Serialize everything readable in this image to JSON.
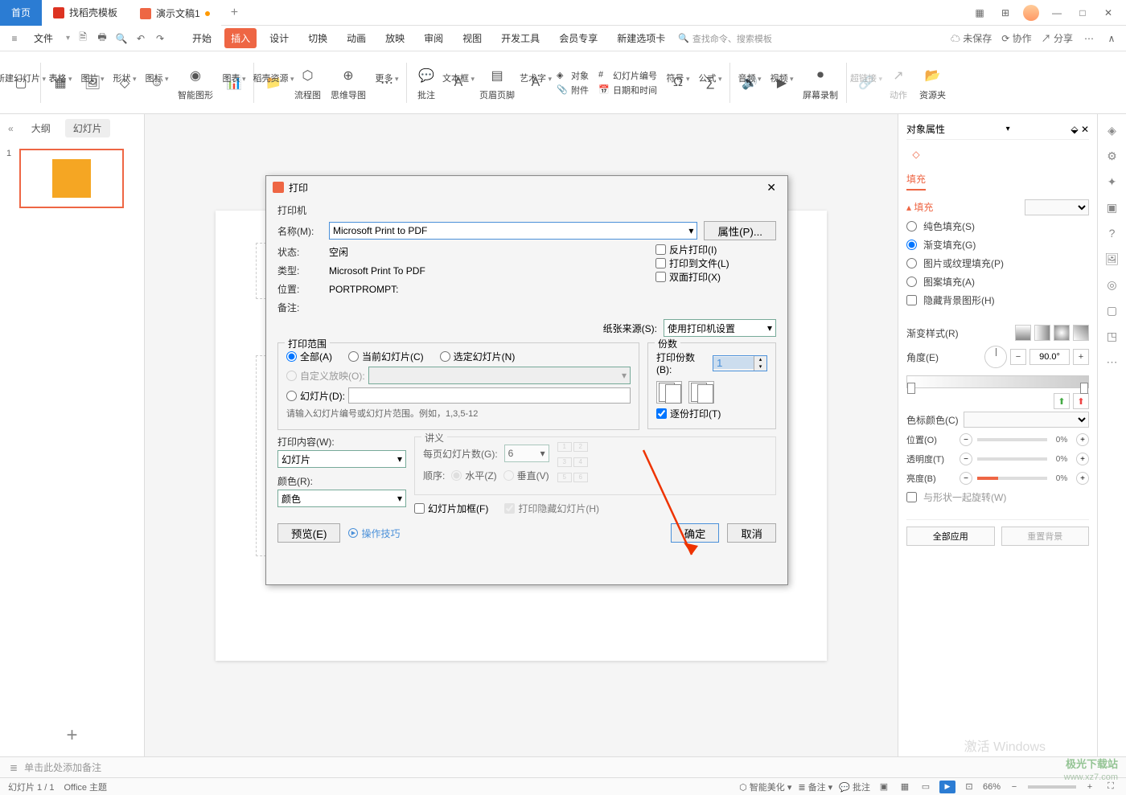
{
  "tabs": {
    "home": "首页",
    "template": "找稻壳模板",
    "doc": "演示文稿1"
  },
  "menubar": {
    "file": "文件",
    "items": [
      "开始",
      "插入",
      "设计",
      "切换",
      "动画",
      "放映",
      "审阅",
      "视图",
      "开发工具",
      "会员专享",
      "新建选项卡"
    ],
    "active_index": 1,
    "search_placeholder": "查找命令、搜索模板",
    "unsaved": "未保存",
    "collab": "协作",
    "share": "分享"
  },
  "ribbon": {
    "new_slide": "新建幻灯片",
    "table": "表格",
    "image": "图片",
    "shape": "形状",
    "icon": "图标",
    "smart": "智能图形",
    "chart": "图表",
    "resource": "稻壳资源",
    "flowchart": "流程图",
    "mindmap": "思维导图",
    "more": "更多",
    "comment": "批注",
    "textbox": "文本框",
    "header_footer": "页眉页脚",
    "wordart": "艺术字",
    "object": "对象",
    "attach": "附件",
    "slide_number": "幻灯片编号",
    "datetime": "日期和时间",
    "symbol": "符号",
    "formula": "公式",
    "audio": "音频",
    "video": "视频",
    "screen_record": "屏幕录制",
    "hyperlink": "超链接",
    "action": "动作",
    "resource_pane": "资源夹"
  },
  "outline": {
    "tab_outline": "大纲",
    "tab_slides": "幻灯片",
    "slide_num": "1"
  },
  "props": {
    "title": "对象属性",
    "fill_tab": "填充",
    "section_fill": "填充",
    "solid": "纯色填充(S)",
    "gradient": "渐变填充(G)",
    "picture": "图片或纹理填充(P)",
    "pattern": "图案填充(A)",
    "hide_bg": "隐藏背景图形(H)",
    "grad_style": "渐变样式(R)",
    "angle": "角度(E)",
    "angle_val": "90.0°",
    "color_label": "色标颜色(C)",
    "pos": "位置(O)",
    "pos_val": "0%",
    "trans": "透明度(T)",
    "trans_val": "0%",
    "bright": "亮度(B)",
    "bright_val": "0%",
    "rotate_with_shape": "与形状一起旋转(W)",
    "apply_all": "全部应用",
    "reset_bg": "重置背景"
  },
  "notes": {
    "placeholder": "单击此处添加备注"
  },
  "statusbar": {
    "slide_info": "幻灯片 1 / 1",
    "theme": "Office 主题",
    "beautify": "智能美化",
    "notes": "备注",
    "comments": "批注",
    "zoom": "66%"
  },
  "dialog": {
    "title": "打印",
    "printer_section": "打印机",
    "name_label": "名称(M):",
    "name_value": "Microsoft Print to PDF",
    "properties_btn": "属性(P)...",
    "status_label": "状态:",
    "status_value": "空闲",
    "type_label": "类型:",
    "type_value": "Microsoft Print To PDF",
    "where_label": "位置:",
    "where_value": "PORTPROMPT:",
    "comment_label": "备注:",
    "reverse": "反片打印(I)",
    "to_file": "打印到文件(L)",
    "duplex": "双面打印(X)",
    "paper_source_label": "纸张来源(S):",
    "paper_source_value": "使用打印机设置",
    "range_section": "打印范围",
    "all": "全部(A)",
    "current": "当前幻灯片(C)",
    "selection": "选定幻灯片(N)",
    "custom_show": "自定义放映(O):",
    "slides_radio": "幻灯片(D):",
    "range_hint": "请输入幻灯片编号或幻灯片范围。例如，1,3,5-12",
    "copies_section": "份数",
    "copies_label": "打印份数(B):",
    "copies_value": "1",
    "collate": "逐份打印(T)",
    "content_label": "打印内容(W):",
    "content_value": "幻灯片",
    "color_label": "颜色(R):",
    "color_value": "颜色",
    "handout_section": "讲义",
    "per_page_label": "每页幻灯片数(G):",
    "per_page_value": "6",
    "order_label": "顺序:",
    "horizontal": "水平(Z)",
    "vertical": "垂直(V)",
    "frame": "幻灯片加框(F)",
    "print_hidden": "打印隐藏幻灯片(H)",
    "preview": "预览(E)",
    "tips": "操作技巧",
    "ok": "确定",
    "cancel": "取消"
  },
  "watermark": {
    "logo": "极光下载站",
    "url": "www.xz7.com",
    "activation": "激活 Windows"
  }
}
